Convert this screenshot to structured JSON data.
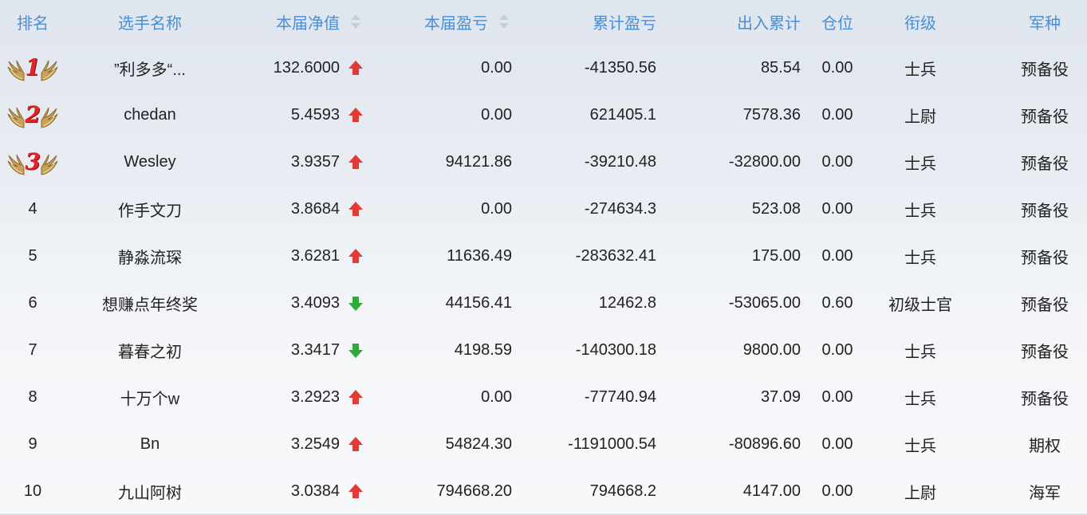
{
  "headers": {
    "rank": "排名",
    "name": "选手名称",
    "nav": "本届净值",
    "pnl": "本届盈亏",
    "cum_pnl": "累计盈亏",
    "flow": "出入累计",
    "position": "仓位",
    "title": "衔级",
    "army": "军种"
  },
  "colors": {
    "header_text": "#4a8fd6",
    "up_arrow": "#e53935",
    "down_arrow": "#2eaa3c",
    "medal_number": "#e2252b"
  },
  "rows": [
    {
      "rank": "1",
      "medal": true,
      "name": "”利多多“...",
      "nav": "132.6000",
      "trend": "up",
      "pnl": "0.00",
      "cum_pnl": "-41350.56",
      "flow": "85.54",
      "position": "0.00",
      "title": "士兵",
      "army": "预备役"
    },
    {
      "rank": "2",
      "medal": true,
      "name": "chedan",
      "nav": "5.4593",
      "trend": "up",
      "pnl": "0.00",
      "cum_pnl": "621405.1",
      "flow": "7578.36",
      "position": "0.00",
      "title": "上尉",
      "army": "预备役"
    },
    {
      "rank": "3",
      "medal": true,
      "name": "Wesley",
      "nav": "3.9357",
      "trend": "up",
      "pnl": "94121.86",
      "cum_pnl": "-39210.48",
      "flow": "-32800.00",
      "position": "0.00",
      "title": "士兵",
      "army": "预备役"
    },
    {
      "rank": "4",
      "medal": false,
      "name": "作手文刀",
      "nav": "3.8684",
      "trend": "up",
      "pnl": "0.00",
      "cum_pnl": "-274634.3",
      "flow": "523.08",
      "position": "0.00",
      "title": "士兵",
      "army": "预备役"
    },
    {
      "rank": "5",
      "medal": false,
      "name": "静淼流琛",
      "nav": "3.6281",
      "trend": "up",
      "pnl": "11636.49",
      "cum_pnl": "-283632.41",
      "flow": "175.00",
      "position": "0.00",
      "title": "士兵",
      "army": "预备役"
    },
    {
      "rank": "6",
      "medal": false,
      "name": "想赚点年终奖",
      "nav": "3.4093",
      "trend": "down",
      "pnl": "44156.41",
      "cum_pnl": "12462.8",
      "flow": "-53065.00",
      "position": "0.60",
      "title": "初级士官",
      "army": "预备役"
    },
    {
      "rank": "7",
      "medal": false,
      "name": "暮春之初",
      "nav": "3.3417",
      "trend": "down",
      "pnl": "4198.59",
      "cum_pnl": "-140300.18",
      "flow": "9800.00",
      "position": "0.00",
      "title": "士兵",
      "army": "预备役"
    },
    {
      "rank": "8",
      "medal": false,
      "name": "十万个w",
      "nav": "3.2923",
      "trend": "up",
      "pnl": "0.00",
      "cum_pnl": "-77740.94",
      "flow": "37.09",
      "position": "0.00",
      "title": "士兵",
      "army": "预备役"
    },
    {
      "rank": "9",
      "medal": false,
      "name": "Bn",
      "nav": "3.2549",
      "trend": "up",
      "pnl": "54824.30",
      "cum_pnl": "-1191000.54",
      "flow": "-80896.60",
      "position": "0.00",
      "title": "士兵",
      "army": "期权"
    },
    {
      "rank": "10",
      "medal": false,
      "name": "九山阿树",
      "nav": "3.0384",
      "trend": "up",
      "pnl": "794668.20",
      "cum_pnl": "794668.2",
      "flow": "4147.00",
      "position": "0.00",
      "title": "上尉",
      "army": "海军"
    }
  ]
}
